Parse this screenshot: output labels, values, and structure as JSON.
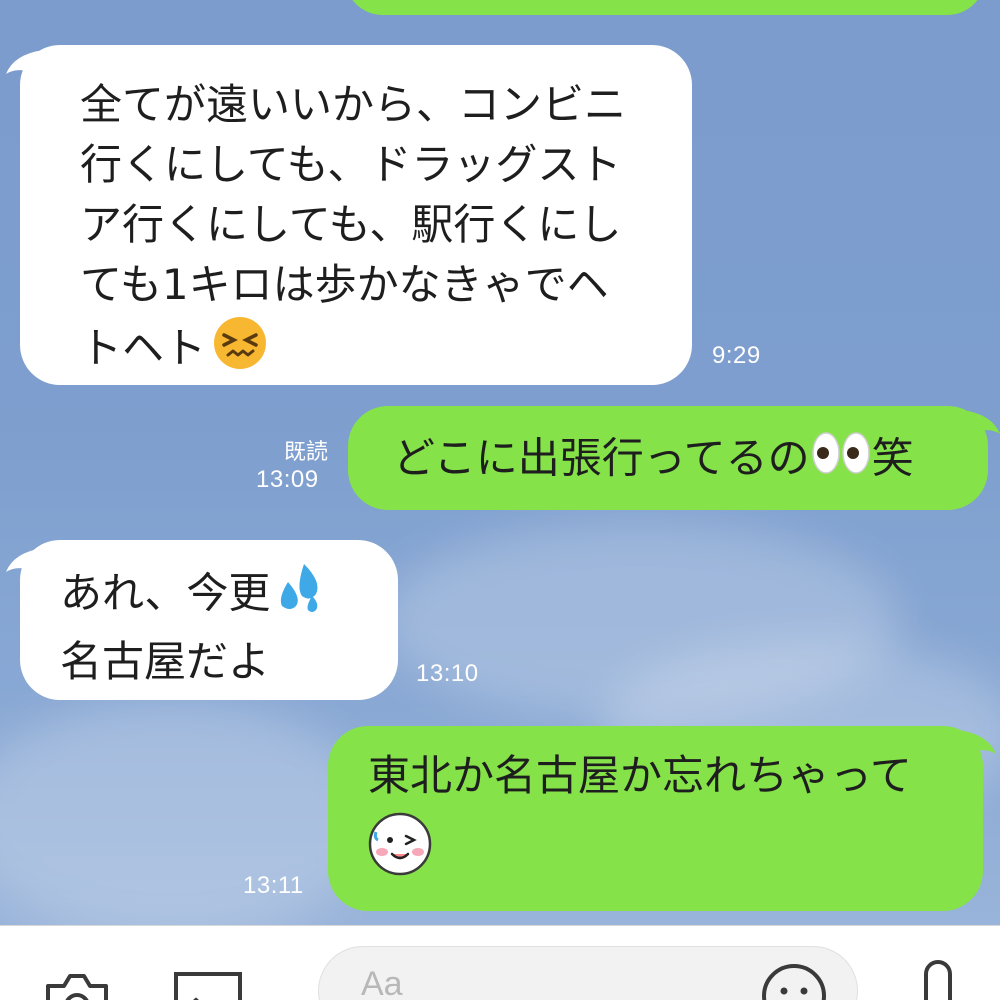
{
  "messages": [
    {
      "side": "incoming",
      "lines": [
        "全てが遠いいから、コンビニ",
        "行くにしても、ドラッグスト",
        "ア行くにしても、駅行くにし",
        "ても1キロは歩かなきゃでヘ",
        "トヘト"
      ],
      "emoji": "confounded-face",
      "time": "9:29"
    },
    {
      "side": "outgoing",
      "text": "どこに出張行ってるの",
      "trailing_text": "笑",
      "emoji": "eyes",
      "read_label": "既読",
      "time": "13:09"
    },
    {
      "side": "incoming",
      "lines": [
        "あれ、今更",
        "名古屋だよ"
      ],
      "emoji": "sweat-droplets",
      "time": "13:10"
    },
    {
      "side": "outgoing",
      "text": "東北か名古屋か忘れちゃって",
      "emoji": "winking-face-sticker",
      "time": "13:11"
    }
  ],
  "input_bar": {
    "placeholder": "Aa",
    "icons": [
      "camera-icon",
      "image-icon",
      "emoji-icon",
      "microphone-icon"
    ]
  },
  "colors": {
    "outgoing_bubble": "#85e249",
    "incoming_bubble": "#ffffff",
    "background": "#7b9ccd"
  }
}
